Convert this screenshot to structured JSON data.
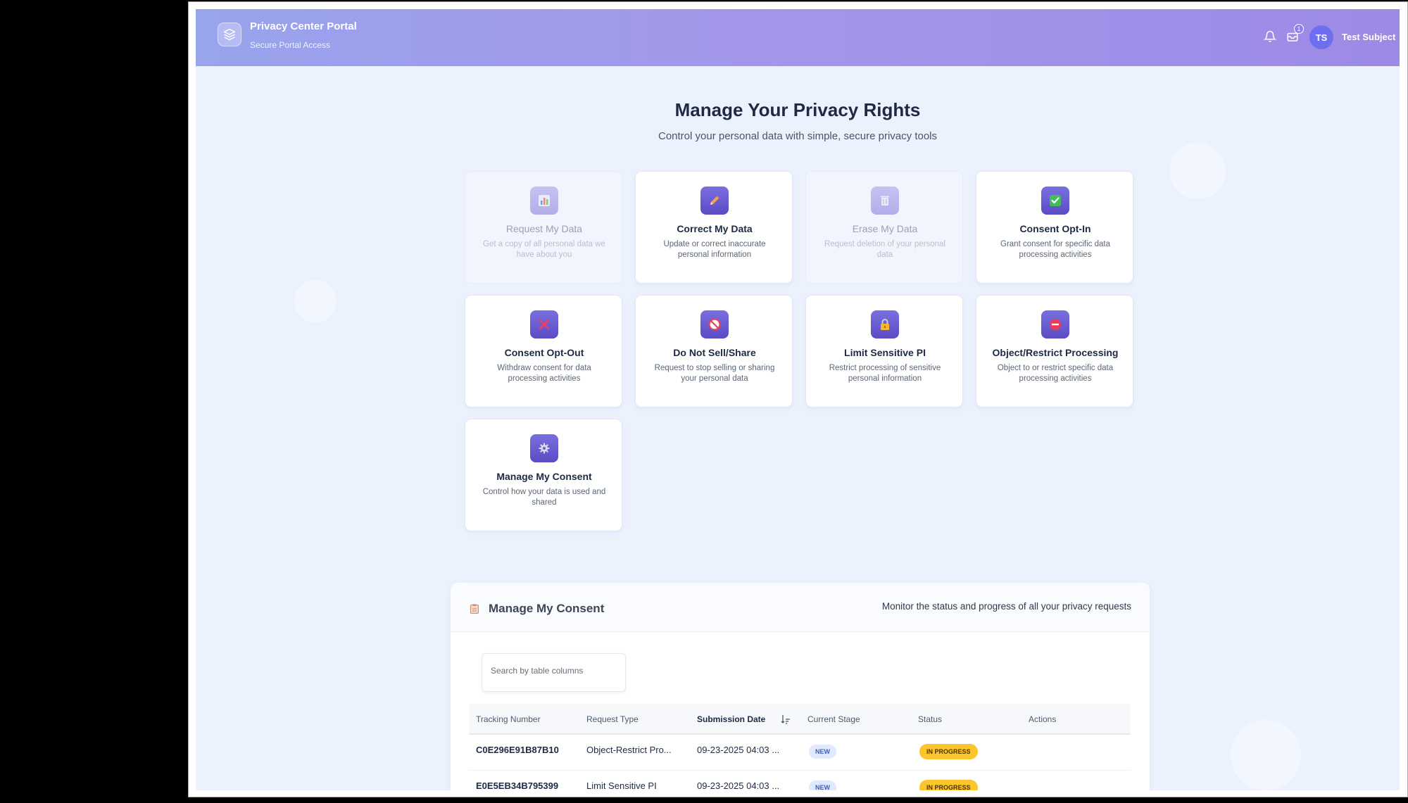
{
  "header": {
    "title": "Privacy Center Portal",
    "subtitle": "Secure Portal Access",
    "notification_count": "1",
    "avatar_initials": "TS",
    "user_name": "Test Subject"
  },
  "hero": {
    "title": "Manage Your Privacy Rights",
    "subtitle": "Control your personal data with simple, secure privacy tools"
  },
  "cards": [
    {
      "title": "Request My Data",
      "desc": "Get a copy of all personal data we have about you",
      "icon": "chart-icon",
      "enabled": false
    },
    {
      "title": "Correct My Data",
      "desc": "Update or correct inaccurate personal information",
      "icon": "pencil-icon",
      "enabled": true
    },
    {
      "title": "Erase My Data",
      "desc": "Request deletion of your personal data",
      "icon": "trash-icon",
      "enabled": false
    },
    {
      "title": "Consent Opt-In",
      "desc": "Grant consent for specific data processing activities",
      "icon": "check-box-icon",
      "enabled": true
    },
    {
      "title": "Consent Opt-Out",
      "desc": "Withdraw consent for data processing activities",
      "icon": "cross-icon",
      "enabled": true
    },
    {
      "title": "Do Not Sell/Share",
      "desc": "Request to stop selling or sharing your personal data",
      "icon": "prohibited-icon",
      "enabled": true
    },
    {
      "title": "Limit Sensitive PI",
      "desc": "Restrict processing of sensitive personal information",
      "icon": "lock-icon",
      "enabled": true
    },
    {
      "title": "Object/Restrict Processing",
      "desc": "Object to or restrict specific data processing activities",
      "icon": "no-entry-icon",
      "enabled": true
    },
    {
      "title": "Manage My Consent",
      "desc": "Control how your data is used and shared",
      "icon": "gear-icon",
      "enabled": true
    }
  ],
  "requests": {
    "title": "Manage My Consent",
    "subtitle": "Monitor the status and progress of all your privacy requests",
    "search_placeholder": "Search by table columns",
    "columns": [
      "Tracking Number",
      "Request Type",
      "Submission Date",
      "Current Stage",
      "Status",
      "Actions"
    ],
    "rows": [
      {
        "tracking": "C0E296E91B87B10",
        "type": "Object-Restrict Pro...",
        "date": "09-23-2025 04:03 ...",
        "stage": "NEW",
        "status": "IN PROGRESS"
      },
      {
        "tracking": "E0E5EB34B795399",
        "type": "Limit Sensitive PI",
        "date": "09-23-2025 04:03 ...",
        "stage": "NEW",
        "status": "IN PROGRESS"
      }
    ]
  },
  "colors": {
    "header_gradient_start": "#98a4ec",
    "header_gradient_end": "#9c8ae6",
    "page_background": "#ecf1fe",
    "card_icon_accent": "#6a5dd6",
    "status_in_progress": "#fbc52b",
    "stage_new": "#dfe9ff"
  }
}
